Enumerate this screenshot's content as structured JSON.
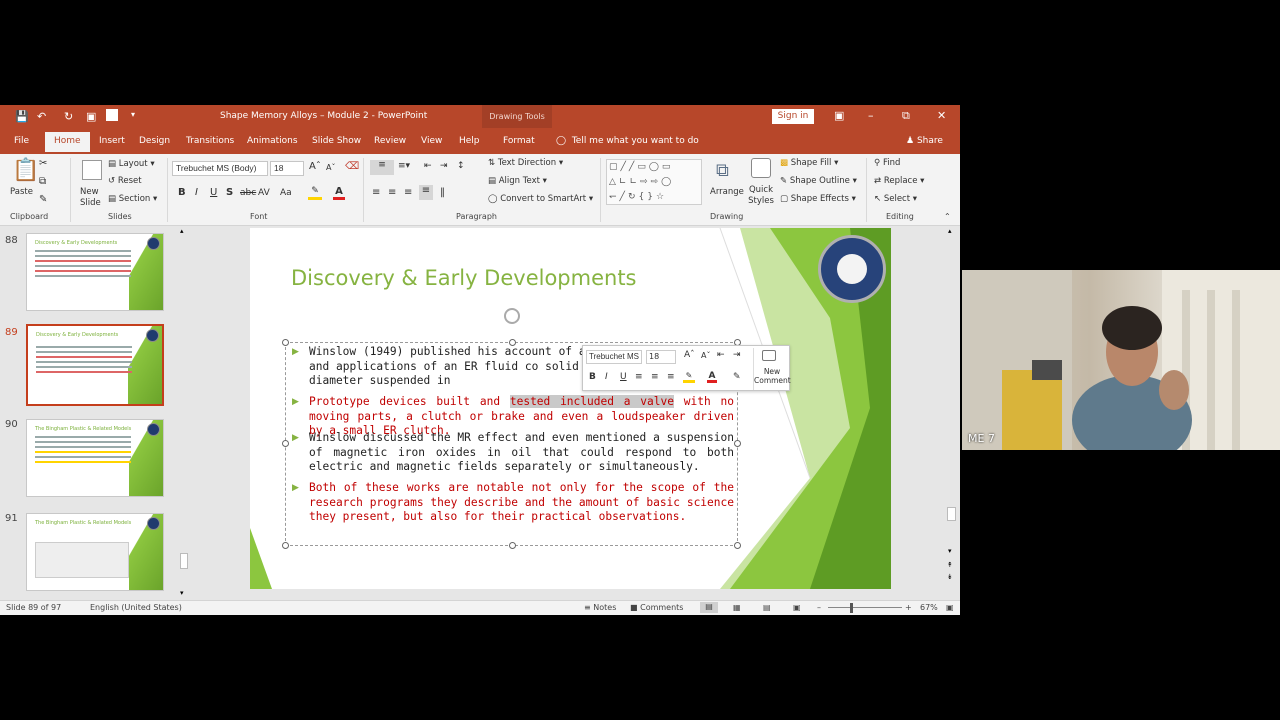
{
  "window": {
    "title": "Shape Memory Alloys – Module 2  -  PowerPoint",
    "contextual_tab_group": "Drawing Tools",
    "sign_in": "Sign in"
  },
  "tabs": [
    "File",
    "Home",
    "Insert",
    "Design",
    "Transitions",
    "Animations",
    "Slide Show",
    "Review",
    "View",
    "Help",
    "Format"
  ],
  "active_tab": "Home",
  "tell_me": "Tell me what you want to do",
  "share": "Share",
  "ribbon": {
    "clipboard": {
      "paste": "Paste",
      "label": "Clipboard"
    },
    "slides": {
      "new_slide": "New Slide",
      "layout": "Layout",
      "reset": "Reset",
      "section": "Section",
      "label": "Slides"
    },
    "font": {
      "name": "Trebuchet MS (Body)",
      "size": "18",
      "label": "Font"
    },
    "paragraph": {
      "text_direction": "Text Direction",
      "align_text": "Align Text",
      "convert_smartart": "Convert to SmartArt",
      "label": "Paragraph"
    },
    "drawing": {
      "arrange": "Arrange",
      "quick_styles": "Quick Styles",
      "shape_fill": "Shape Fill",
      "shape_outline": "Shape Outline",
      "shape_effects": "Shape Effects",
      "label": "Drawing"
    },
    "editing": {
      "find": "Find",
      "replace": "Replace",
      "select": "Select",
      "label": "Editing"
    }
  },
  "thumbnails": [
    {
      "num": "88",
      "title": "Discovery & Early Developments"
    },
    {
      "num": "89",
      "title": "Discovery & Early Developments"
    },
    {
      "num": "90",
      "title": "The Bingham Plastic & Related Models"
    },
    {
      "num": "91",
      "title": "The Bingham Plastic & Related Models"
    }
  ],
  "selected_thumbnail": "89",
  "slide": {
    "title": "Discovery & Early Developments",
    "p1": "Winslow (1949) published his account of a length the properties and applications of an ER fluid co solid particles of about 1µm diameter suspended in",
    "p2_before": "Prototype devices built and ",
    "p2_highlight": "tested included a valve",
    "p2_after": " with no moving parts, a clutch or brake and even a loudspeaker driven by a small ER clutch.",
    "p3": "Winslow discussed the MR effect and even mentioned a suspension of magnetic iron oxides in oil that could respond to both electric and magnetic fields separately or simultaneously.",
    "p4": "Both of these works are notable not only for the scope of the research programs they describe and the amount of basic science they present, but also for their practical observations."
  },
  "mini_toolbar": {
    "font": "Trebuchet MS",
    "size": "18",
    "new_comment": "New Comment"
  },
  "status": {
    "slide_of": "Slide 89 of 97",
    "language": "English (United States)",
    "notes": "Notes",
    "comments": "Comments",
    "zoom": "67%"
  },
  "participant": {
    "label": "ME 7"
  },
  "colors": {
    "accent": "#b7472a",
    "title_green": "#86b341",
    "red_text": "#c00000"
  }
}
